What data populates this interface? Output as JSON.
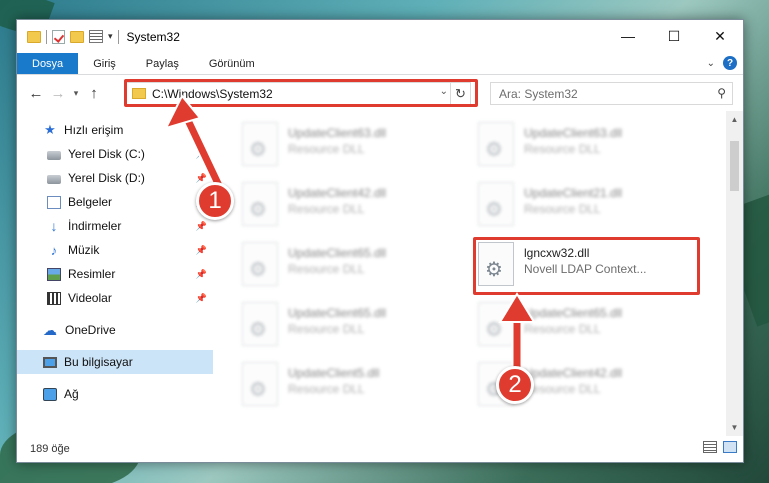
{
  "window": {
    "title": "System32",
    "controls": {
      "minimize": "—",
      "maximize": "☐",
      "close": "✕"
    }
  },
  "ribbon": {
    "tabs": [
      "Dosya",
      "Giriş",
      "Paylaş",
      "Görünüm"
    ],
    "help": "?"
  },
  "address": {
    "path": "C:\\Windows\\System32",
    "search_placeholder": "Ara: System32"
  },
  "nav": {
    "quick_access": "Hızlı erişim",
    "items": [
      {
        "label": "Yerel Disk (C:)",
        "pinned": true
      },
      {
        "label": "Yerel Disk (D:)",
        "pinned": true
      },
      {
        "label": "Belgeler",
        "pinned": true
      },
      {
        "label": "İndirmeler",
        "pinned": true
      },
      {
        "label": "Müzik",
        "pinned": true
      },
      {
        "label": "Resimler",
        "pinned": true
      },
      {
        "label": "Videolar",
        "pinned": true
      }
    ],
    "onedrive": "OneDrive",
    "this_pc": "Bu bilgisayar",
    "network": "Ağ"
  },
  "files": [
    {
      "name": "UpdateClient63.dll",
      "type": "Resource DLL"
    },
    {
      "name": "UpdateClient63.dll",
      "type": "Resource DLL"
    },
    {
      "name": "UpdateClient42.dll",
      "type": "Resource DLL"
    },
    {
      "name": "UpdateClient21.dll",
      "type": "Resource DLL"
    },
    {
      "name": "UpdateClient65.dll",
      "type": "Resource DLL"
    },
    {
      "name": "lgncxw32.dll",
      "type": "Novell LDAP Context..."
    },
    {
      "name": "UpdateClient65.dll",
      "type": "Resource DLL"
    },
    {
      "name": "UpdateClient65.dll",
      "type": "Resource DLL"
    },
    {
      "name": "UpdateClient5.dll",
      "type": "Resource DLL"
    },
    {
      "name": "UpdateClient42.dll",
      "type": "Resource DLL"
    }
  ],
  "status": {
    "item_count": "189 öğe"
  },
  "annotations": {
    "step1": "1",
    "step2": "2",
    "color": "#e03b2f"
  }
}
